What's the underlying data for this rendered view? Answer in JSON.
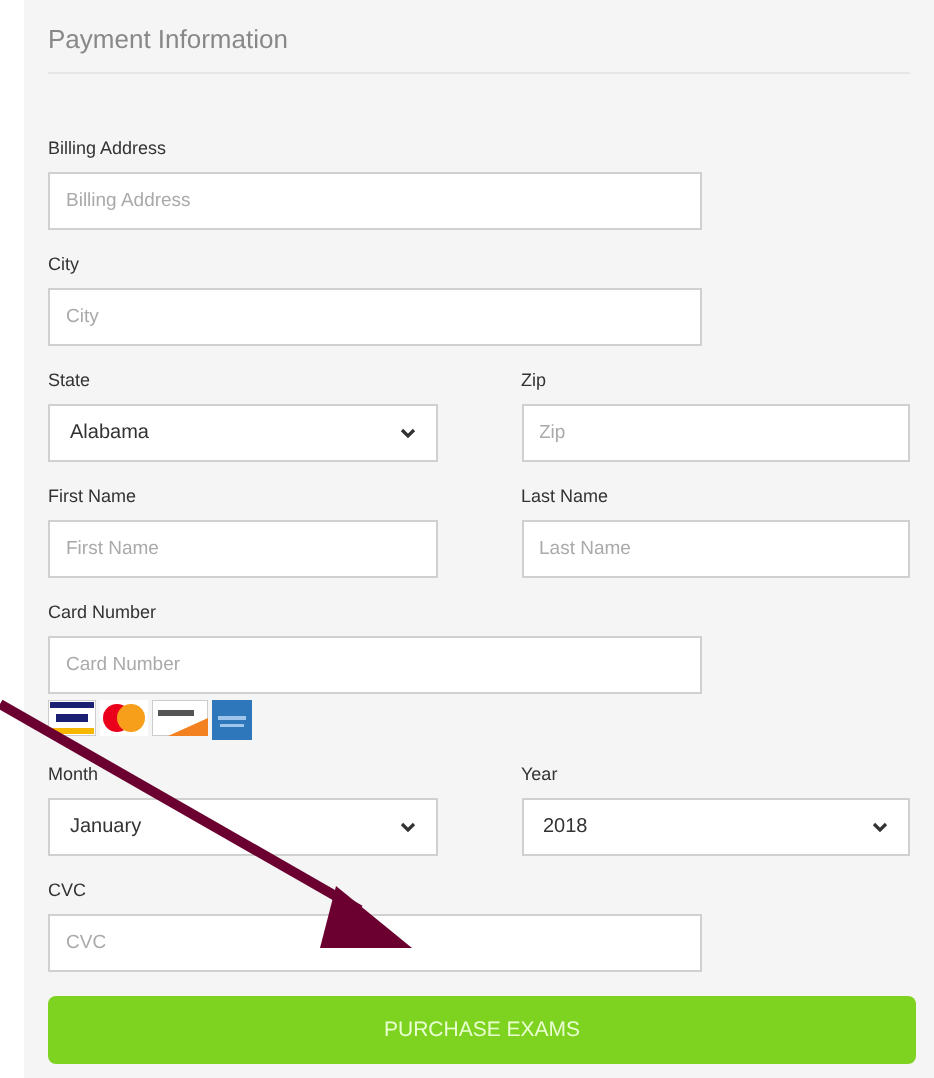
{
  "panel": {
    "title": "Payment Information"
  },
  "fields": [
    {
      "kind": "text",
      "label": "Billing Address",
      "placeholder": "Billing Address",
      "half": false
    },
    {
      "kind": "text",
      "label": "City",
      "placeholder": "City",
      "half": false
    },
    {
      "kind": "select",
      "label": "State",
      "value": "Alabama",
      "half": true
    },
    {
      "kind": "text",
      "label": "Zip",
      "placeholder": "Zip",
      "half": true
    },
    {
      "kind": "text",
      "label": "First Name",
      "placeholder": "First Name",
      "half": true
    },
    {
      "kind": "text",
      "label": "Last Name",
      "placeholder": "Last Name",
      "half": true
    },
    {
      "kind": "card",
      "label": "Card Number",
      "placeholder": "Card Number",
      "half": false
    },
    {
      "kind": "select",
      "label": "Month",
      "value": "January",
      "half": true
    },
    {
      "kind": "select",
      "label": "Year",
      "value": "2018",
      "half": true
    },
    {
      "kind": "text",
      "label": "CVC",
      "placeholder": "CVC",
      "half": false
    }
  ],
  "submit": {
    "label": "PURCHASE EXAMS"
  }
}
